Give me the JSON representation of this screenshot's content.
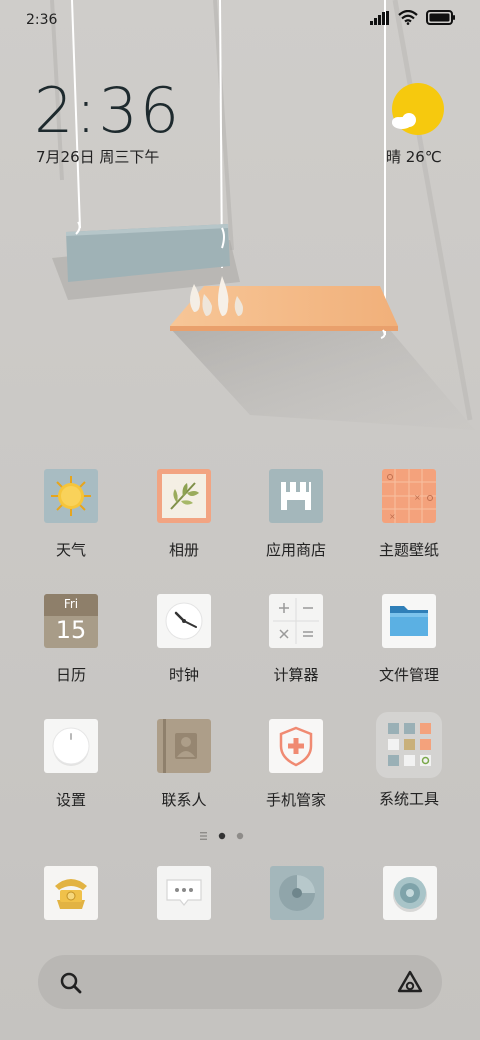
{
  "status_bar": {
    "time": "2:36",
    "signal_icon": "signal-icon",
    "wifi_icon": "wifi-icon",
    "battery_icon": "battery-icon"
  },
  "clock_widget": {
    "time": "2:36",
    "date": "7月26日 周三下午"
  },
  "weather_widget": {
    "icon": "sun-cloud-icon",
    "text": "晴 26℃"
  },
  "apps": [
    {
      "label": "天气",
      "icon": "weather-icon"
    },
    {
      "label": "相册",
      "icon": "gallery-icon"
    },
    {
      "label": "应用商店",
      "icon": "app-store-icon"
    },
    {
      "label": "主题壁纸",
      "icon": "themes-icon"
    },
    {
      "label": "日历",
      "icon": "calendar-icon",
      "day": "Fri",
      "date": "15"
    },
    {
      "label": "时钟",
      "icon": "clock-icon"
    },
    {
      "label": "计算器",
      "icon": "calculator-icon"
    },
    {
      "label": "文件管理",
      "icon": "file-manager-icon"
    },
    {
      "label": "设置",
      "icon": "settings-icon"
    },
    {
      "label": "联系人",
      "icon": "contacts-icon"
    },
    {
      "label": "手机管家",
      "icon": "security-icon"
    },
    {
      "label": "系统工具",
      "icon": "system-tools-folder-icon"
    }
  ],
  "page_indicator": {
    "current_page": 1,
    "total_pages": 2
  },
  "dock": [
    {
      "icon": "phone-icon"
    },
    {
      "icon": "messages-icon"
    },
    {
      "icon": "browser-icon"
    },
    {
      "icon": "camera-icon"
    }
  ],
  "search_bar": {
    "left_icon": "search-icon",
    "right_icon": "assistant-icon"
  },
  "colors": {
    "background": "#c8c6c3",
    "accent_orange": "#f4a27c",
    "sun_yellow": "#f6c90e"
  }
}
